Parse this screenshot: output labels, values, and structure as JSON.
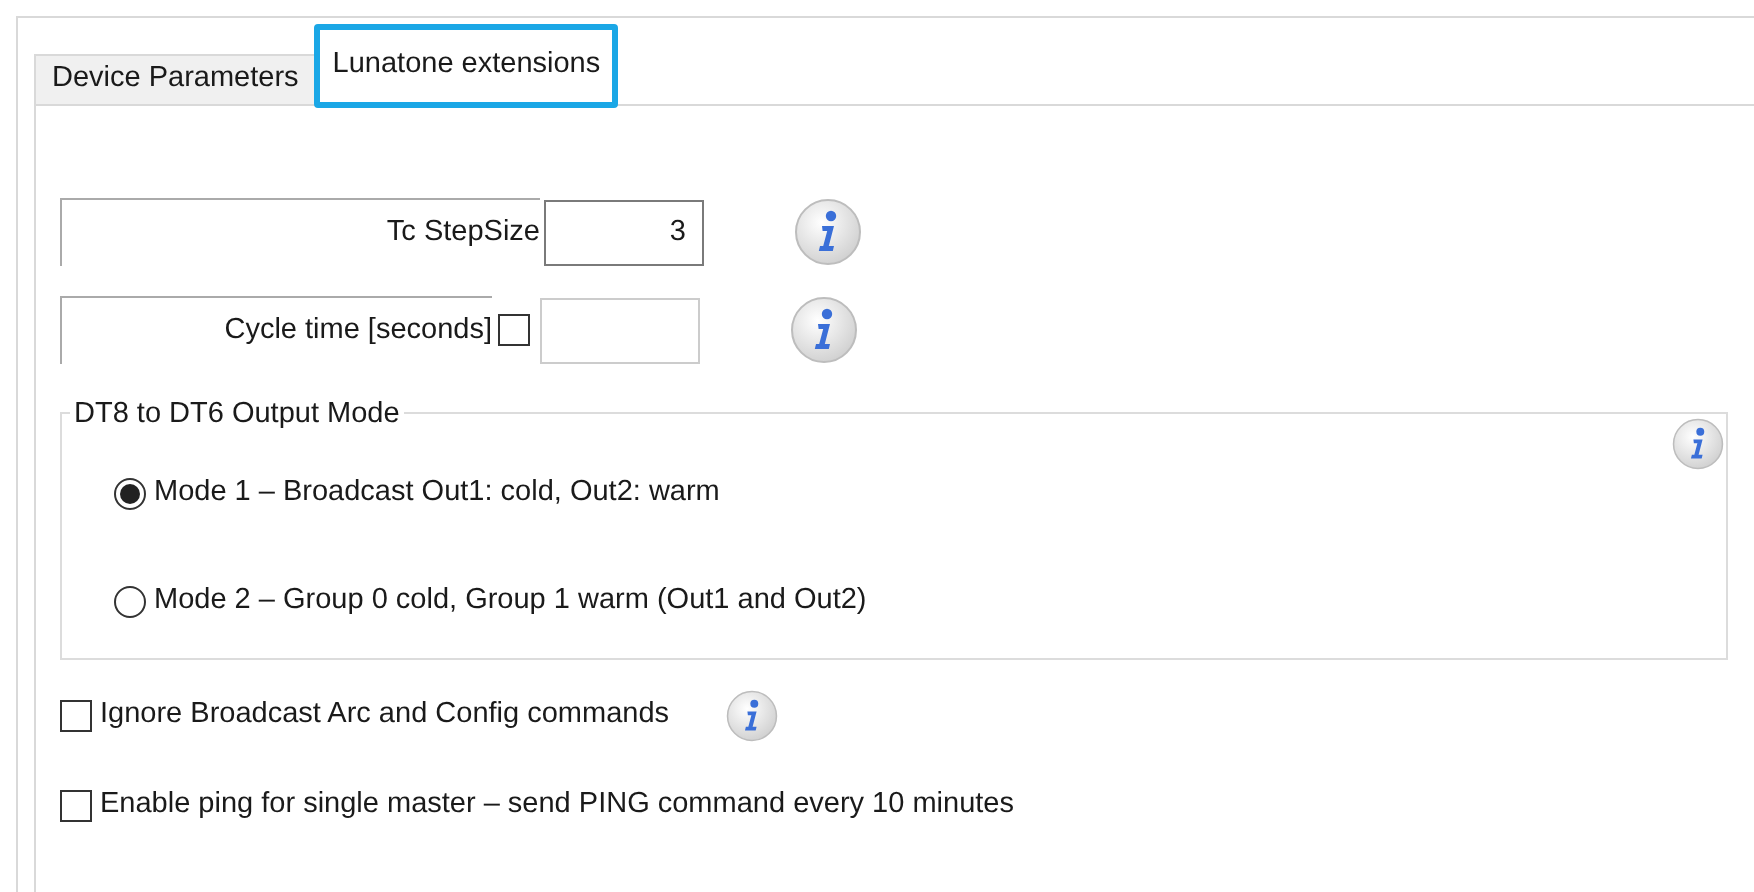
{
  "tabs": [
    {
      "label": "Device Parameters",
      "selected": false
    },
    {
      "label": "Lunatone extensions",
      "selected": true
    }
  ],
  "fields": [
    {
      "label": "Tc StepSize",
      "kind": "input",
      "value": "3"
    },
    {
      "label": "Cycle time [seconds]",
      "kind": "checkbox-input",
      "checked": false
    }
  ],
  "output_mode": {
    "title": "DT8 to DT6 Output Mode",
    "options": [
      {
        "label": "Mode 1 – Broadcast Out1: cold, Out2: warm",
        "selected": true
      },
      {
        "label": "Mode 2 – Group 0 cold, Group 1 warm (Out1 and Out2)",
        "selected": false
      }
    ]
  },
  "options": [
    {
      "label": "Ignore Broadcast Arc and Config commands",
      "checked": false,
      "info": true
    },
    {
      "label": "Enable ping for single master – send PING command every 10 minutes",
      "checked": false,
      "info": false
    }
  ]
}
